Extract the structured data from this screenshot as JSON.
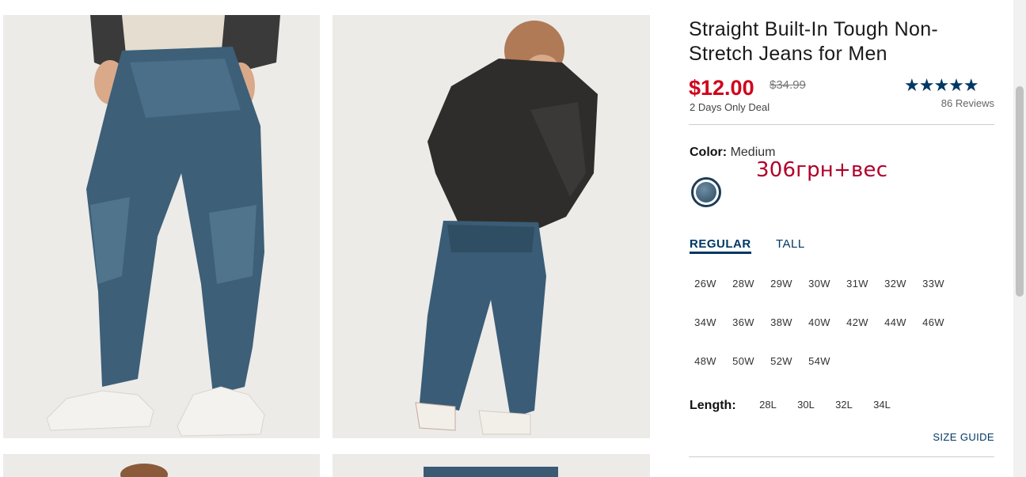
{
  "product": {
    "title": "Straight Built-In Tough Non-Stretch Jeans for Men",
    "price": "$12.00",
    "old_price": "$34.99",
    "deal": "2 Days Only Deal",
    "stars": "★★★★★",
    "reviews": "86 Reviews",
    "rating_color": "#003764",
    "price_color": "#d0021b"
  },
  "color": {
    "label": "Color:",
    "value": "Medium"
  },
  "annotation": "306грн+вес",
  "fit_tabs": [
    {
      "label": "REGULAR",
      "active": true
    },
    {
      "label": "TALL",
      "active": false
    }
  ],
  "waist_sizes": [
    [
      "26W",
      "28W",
      "29W",
      "30W",
      "31W",
      "32W",
      "33W"
    ],
    [
      "34W",
      "36W",
      "38W",
      "40W",
      "42W",
      "44W",
      "46W"
    ],
    [
      "48W",
      "50W",
      "52W",
      "54W"
    ]
  ],
  "length": {
    "label": "Length:",
    "options": [
      "28L",
      "30L",
      "32L",
      "34L"
    ]
  },
  "size_guide": "SIZE GUIDE",
  "images": [
    {
      "icon": "product-photo-front"
    },
    {
      "icon": "product-photo-back"
    },
    {
      "icon": "product-photo-detail"
    },
    {
      "icon": "product-photo-flat"
    }
  ]
}
